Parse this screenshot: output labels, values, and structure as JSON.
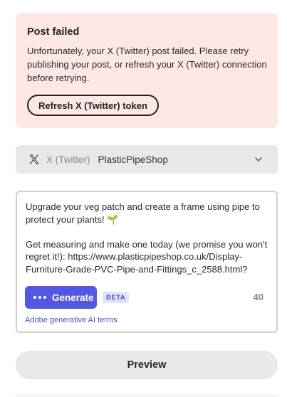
{
  "alert": {
    "title": "Post failed",
    "message": "Unfortunately, your X (Twitter) post failed. Please retry publishing your post, or refresh your X (Twitter) connection before retrying.",
    "refresh_button_label": "Refresh X (Twitter) token",
    "background_color": "#fde8e5"
  },
  "account": {
    "platform_icon": "x-logo-icon",
    "platform_label": "X (Twitter)",
    "account_name": "PlasticPipeShop",
    "dropdown_icon": "chevron-down-icon"
  },
  "composer": {
    "post_text": "Upgrade your veg patch and create a frame using pipe to protect your plants! 🌱\n\nGet measuring and make one today (we promise you won't regret it!): https://www.plasticpipeshop.co.uk/Display-Furniture-Grade-PVC-Pipe-and-Fittings_c_2588.html?",
    "generate_label": "Generate",
    "beta_label": "BETA",
    "char_count": "40",
    "ai_terms_label": "Adobe generative AI terms",
    "accent_color": "#5258e4"
  },
  "preview": {
    "label": "Preview"
  }
}
